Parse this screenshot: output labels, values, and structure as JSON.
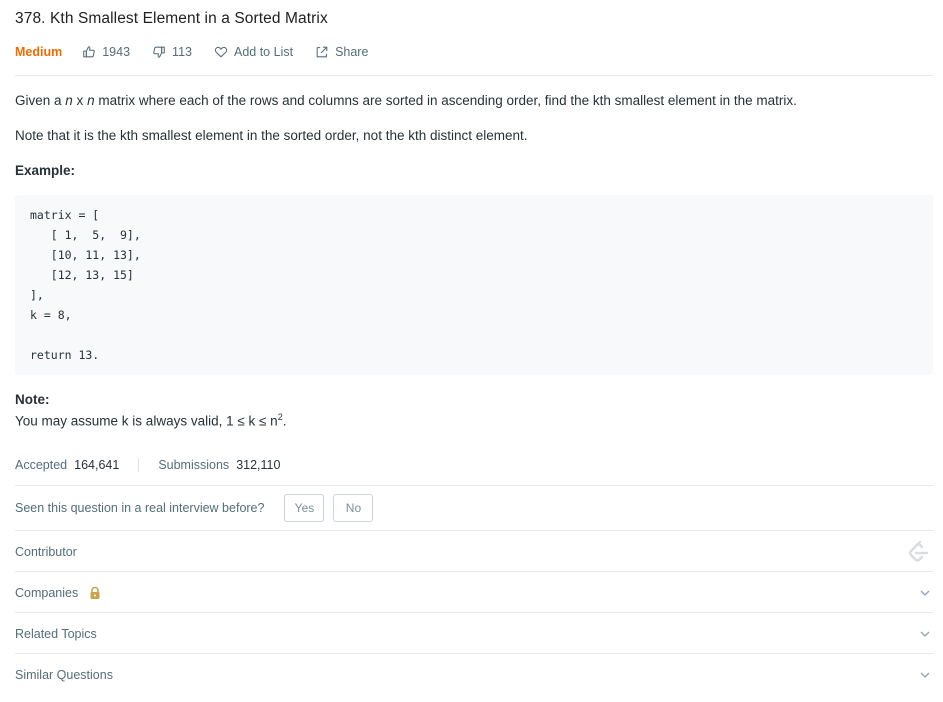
{
  "problem": {
    "title": "378. Kth Smallest Element in a Sorted Matrix",
    "difficulty": "Medium",
    "likes": "1943",
    "dislikes": "113",
    "add_to_list": "Add to List",
    "share": "Share"
  },
  "description": {
    "line1_pre": "Given a ",
    "line1_n1": "n",
    "line1_x": " x ",
    "line1_n2": "n",
    "line1_post": " matrix where each of the rows and columns are sorted in ascending order, find the kth smallest element in the matrix.",
    "line2": "Note that it is the kth smallest element in the sorted order, not the kth distinct element.",
    "example_heading": "Example:",
    "code": "matrix = [\n   [ 1,  5,  9],\n   [10, 11, 13],\n   [12, 13, 15]\n],\nk = 8,\n\nreturn 13.",
    "note_heading": "Note:",
    "note_text": "You may assume k is always valid, 1 ≤ k ≤ n",
    "note_sup": "2",
    "note_end": "."
  },
  "stats": {
    "accepted_label": "Accepted",
    "accepted_value": "164,641",
    "submissions_label": "Submissions",
    "submissions_value": "312,110"
  },
  "interview": {
    "question": "Seen this question in a real interview before?",
    "yes": "Yes",
    "no": "No"
  },
  "sections": {
    "contributor": "Contributor",
    "companies": "Companies",
    "related_topics": "Related Topics",
    "similar_questions": "Similar Questions"
  },
  "colors": {
    "medium": "#ef6c00",
    "lock": "#c9a24b"
  },
  "icons": [
    "thumbs-up-icon",
    "thumbs-down-icon",
    "heart-icon",
    "share-icon",
    "lock-icon",
    "leetcode-logo-icon",
    "chevron-down-icon"
  ]
}
